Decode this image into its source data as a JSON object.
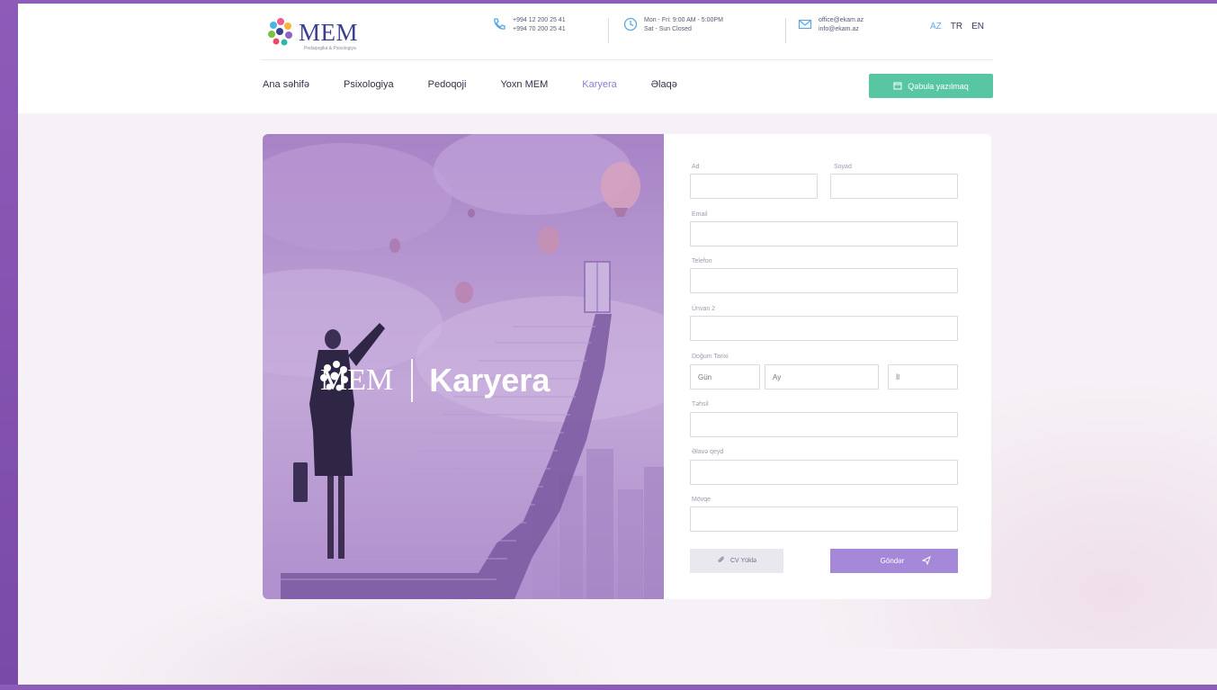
{
  "brand": {
    "name": "MEM",
    "tagline": "Pedaqogika & Psixologiya",
    "accent": "#8f7bd6",
    "cta_color": "#58c6a3",
    "frame_color": "#8d5bb8"
  },
  "contacts": {
    "phone": {
      "icon": "phone-icon",
      "line1": "+994 12 200 25 41",
      "line2": "+994 70 200 25 41"
    },
    "hours": {
      "icon": "clock-icon",
      "line1": "Mon - Fri: 9:00 AM - 5:00PM",
      "line2": "Sat - Sun Closed"
    },
    "email": {
      "icon": "mail-icon",
      "line1": "office@ekam.az",
      "line2": "info@ekam.az"
    }
  },
  "languages": [
    "AZ",
    "TR",
    "EN"
  ],
  "active_language": "AZ",
  "nav": {
    "items": [
      "Ana səhifə",
      "Psixologiya",
      "Pedoqoji",
      "Yoxn MEM",
      "Karyera",
      "Əlaqə"
    ],
    "active": "Karyera",
    "cta_label": "Qəbula yazılmaq"
  },
  "hero": {
    "logo_text": "MEM",
    "logo_sub": "Pedaqogika & Psixologiya",
    "title": "Karyera"
  },
  "form": {
    "name_label": "Ad",
    "surname_label": "Soyad",
    "email_label": "Email",
    "phone_label": "Telefon",
    "profession_label": "Ünvan 2",
    "birth_label": "Doğum Tarixi",
    "day_placeholder": "Gün",
    "month_placeholder": "Ay",
    "year_placeholder": "İl",
    "education_label": "Təhsil",
    "experience_label": "Əlavə qeyd",
    "notes_label": "Mövqe",
    "cv_label": "CV Yüklə",
    "submit_label": "Göndər"
  }
}
